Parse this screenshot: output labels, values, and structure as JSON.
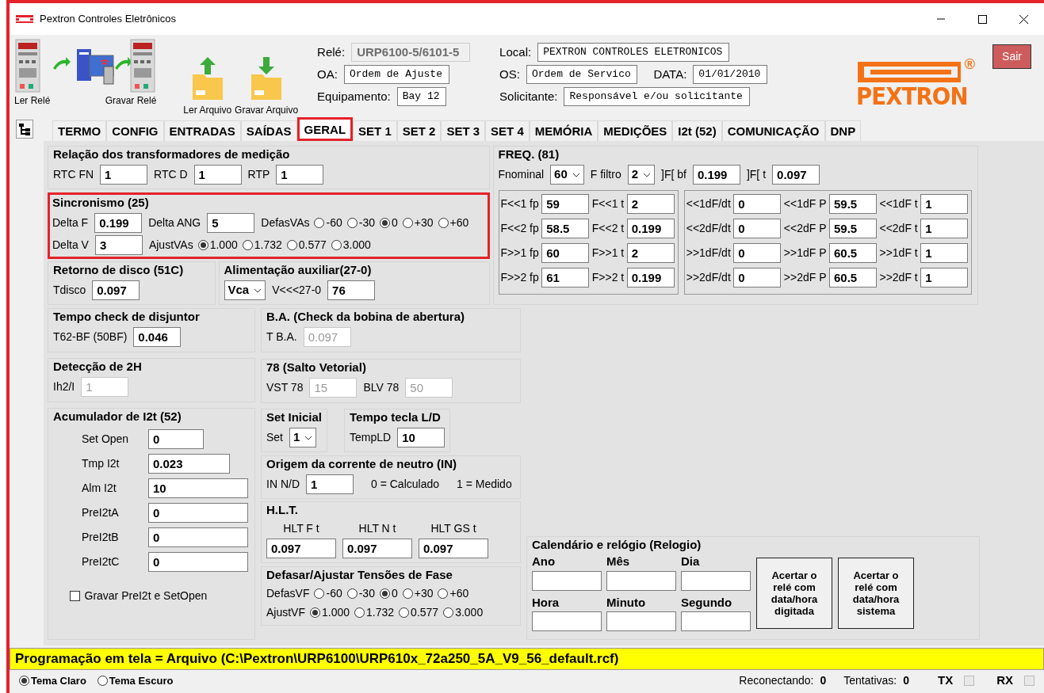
{
  "window": {
    "title": "Pextron Controles Eletrônicos"
  },
  "toolbar": {
    "buttons": [
      {
        "kind": "read_relay",
        "label": "Ler Relé"
      },
      {
        "kind": "write_relay",
        "label": "Gravar Relé"
      },
      {
        "kind": "open_file",
        "label": "Ler Arquivo"
      },
      {
        "kind": "save_file",
        "label": "Gravar Arquivo"
      }
    ]
  },
  "header": {
    "rows": [
      [
        {
          "label": "Relé:",
          "value": "URP6100-5/6101-5",
          "disabled": true
        },
        {
          "label": "Local:",
          "value": "PEXTRON CONTROLES ELETRONICOS",
          "disabled": false
        }
      ],
      [
        {
          "label": "OA:",
          "value": "Ordem de Ajuste",
          "disabled": false
        },
        {
          "label": "OS:",
          "value": "Ordem de Servico",
          "disabled": false
        },
        {
          "label": "DATA:",
          "value": "01/01/2010",
          "disabled": false
        }
      ],
      [
        {
          "label": "Equipamento:",
          "value": "Bay 12",
          "disabled": false
        },
        {
          "label": "Solicitante:",
          "value": "Responsável e/ou solicitante",
          "disabled": false
        }
      ]
    ]
  },
  "logo": {
    "text": "PEXTRON",
    "mark": "®"
  },
  "exit_button": "Sair",
  "tabs": [
    {
      "label": "TERMO",
      "selected": false
    },
    {
      "label": "CONFIG",
      "selected": false
    },
    {
      "label": "ENTRADAS",
      "selected": false
    },
    {
      "label": "SAÍDAS",
      "selected": false
    },
    {
      "label": "GERAL",
      "selected": true
    },
    {
      "label": "SET 1",
      "selected": false
    },
    {
      "label": "SET 2",
      "selected": false
    },
    {
      "label": "SET 3",
      "selected": false
    },
    {
      "label": "SET 4",
      "selected": false
    },
    {
      "label": "MEMÓRIA",
      "selected": false
    },
    {
      "label": "MEDIÇÕES",
      "selected": false
    },
    {
      "label": "I2t (52)",
      "selected": false
    },
    {
      "label": "COMUNICAÇÃO",
      "selected": false
    },
    {
      "label": "DNP",
      "selected": false
    }
  ],
  "panel": {
    "top_left": [
      {
        "kind": "form",
        "title": "Relação dos transformadores de medição",
        "highlighted": false,
        "rows": [
          [
            {
              "kind": "field",
              "label": "RTC FN",
              "value": "1",
              "disabled": false
            },
            {
              "kind": "field",
              "label": "RTC D",
              "value": "1",
              "disabled": false
            },
            {
              "kind": "field",
              "label": "RTP",
              "value": "1",
              "disabled": false
            }
          ]
        ]
      },
      {
        "kind": "form",
        "title": "Sincronismo (25)",
        "highlighted": true,
        "rows": [
          [
            {
              "kind": "field",
              "label": "Delta F",
              "value": "0.199",
              "disabled": false
            },
            {
              "kind": "field",
              "label": "Delta ANG",
              "value": "5",
              "disabled": false
            },
            {
              "kind": "radios",
              "label": "DefasVAs",
              "options": [
                {
                  "label": "-60",
                  "selected": false
                },
                {
                  "label": "-30",
                  "selected": false
                },
                {
                  "label": "0",
                  "selected": true
                },
                {
                  "label": "+30",
                  "selected": false
                },
                {
                  "label": "+60",
                  "selected": false
                }
              ]
            }
          ],
          [
            {
              "kind": "field",
              "label": "Delta V",
              "value": "3",
              "disabled": false
            },
            {
              "kind": "radios",
              "label": "AjustVAs",
              "options": [
                {
                  "label": "1.000",
                  "selected": true
                },
                {
                  "label": "1.732",
                  "selected": false
                },
                {
                  "label": "0.577",
                  "selected": false
                },
                {
                  "label": "3.000",
                  "selected": false
                }
              ]
            }
          ]
        ]
      }
    ],
    "top_left_pair": [
      {
        "kind": "form",
        "title": "Retorno de disco (51C)",
        "highlighted": false,
        "rows": [
          [
            {
              "kind": "field",
              "label": "Tdisco",
              "value": "0.097",
              "disabled": false
            }
          ]
        ]
      },
      {
        "kind": "form",
        "title": "Alimentação auxiliar(27-0)",
        "highlighted": false,
        "rows": [
          [
            {
              "kind": "select",
              "value": "Vca"
            },
            {
              "kind": "field",
              "label": "V<<<27-0",
              "value": "76",
              "disabled": false
            }
          ]
        ]
      }
    ],
    "freq": {
      "kind": "freq",
      "title": "FREQ. (81)",
      "highlighted": false,
      "rows": [
        [
          {
            "kind": "select",
            "label": "Fnominal",
            "value": "60"
          },
          {
            "kind": "select",
            "label": "F filtro",
            "value": "2"
          },
          {
            "kind": "field",
            "label": "]F[  bf",
            "value": "0.199",
            "disabled": false
          },
          {
            "kind": "field",
            "label": "]F[  t",
            "value": "0.097",
            "disabled": false
          }
        ]
      ],
      "grids": [
        {
          "rows": [
            [
              {
                "kind": "field",
                "label": "F<<1 fp",
                "value": "59",
                "disabled": false
              },
              {
                "kind": "field",
                "label": "F<<1 t",
                "value": "2",
                "disabled": false
              }
            ],
            [
              {
                "kind": "field",
                "label": "F<<2 fp",
                "value": "58.5",
                "disabled": false
              },
              {
                "kind": "field",
                "label": "F<<2 t",
                "value": "0.199",
                "disabled": false
              }
            ],
            [
              {
                "kind": "field",
                "label": "F>>1 fp",
                "value": "60",
                "disabled": false
              },
              {
                "kind": "field",
                "label": "F>>1 t",
                "value": "2",
                "disabled": false
              }
            ],
            [
              {
                "kind": "field",
                "label": "F>>2 fp",
                "value": "61",
                "disabled": false
              },
              {
                "kind": "field",
                "label": "F>>2 t",
                "value": "0.199",
                "disabled": false
              }
            ]
          ]
        },
        {
          "rows": [
            [
              {
                "kind": "field",
                "label": "<<1dF/dt",
                "value": "0",
                "disabled": false
              },
              {
                "kind": "field",
                "label": "<<1dF P",
                "value": "59.5",
                "disabled": false
              },
              {
                "kind": "field",
                "label": "<<1dF t",
                "value": "1",
                "disabled": false
              }
            ],
            [
              {
                "kind": "field",
                "label": "<<2dF/dt",
                "value": "0",
                "disabled": false
              },
              {
                "kind": "field",
                "label": "<<2dF P",
                "value": "59.5",
                "disabled": false
              },
              {
                "kind": "field",
                "label": "<<2dF t",
                "value": "1",
                "disabled": false
              }
            ],
            [
              {
                "kind": "field",
                "label": ">>1dF/dt",
                "value": "0",
                "disabled": false
              },
              {
                "kind": "field",
                "label": ">>1dF P",
                "value": "60.5",
                "disabled": false
              },
              {
                "kind": "field",
                "label": ">>1dF t",
                "value": "1",
                "disabled": false
              }
            ],
            [
              {
                "kind": "field",
                "label": ">>2dF/dt",
                "value": "0",
                "disabled": false
              },
              {
                "kind": "field",
                "label": ">>2dF P",
                "value": "60.5",
                "disabled": false
              },
              {
                "kind": "field",
                "label": ">>2dF t",
                "value": "1",
                "disabled": false
              }
            ]
          ]
        }
      ]
    },
    "left": [
      {
        "kind": "form",
        "title": "Tempo check de disjuntor",
        "highlighted": false,
        "rows": [
          [
            {
              "kind": "field",
              "label": "T62-BF (50BF)",
              "value": "0.046",
              "disabled": false
            }
          ]
        ]
      },
      {
        "kind": "form",
        "title": "Detecção de 2H",
        "highlighted": false,
        "rows": [
          [
            {
              "kind": "field",
              "label": "Ih2/I",
              "value": "1",
              "disabled": true
            }
          ]
        ]
      },
      {
        "kind": "table_form",
        "title": "Acumulador de I2t (52)",
        "highlighted": false,
        "rows": [
          [
            {
              "kind": "field",
              "label": "Set Open",
              "value": "0",
              "disabled": false
            }
          ],
          [
            {
              "kind": "field",
              "label": "Tmp I2t",
              "value": "0.023",
              "disabled": false
            }
          ],
          [
            {
              "kind": "field",
              "label": "Alm I2t",
              "value": "10",
              "disabled": false
            }
          ],
          [
            {
              "kind": "field",
              "label": "PreI2tA",
              "value": "0",
              "disabled": false
            }
          ],
          [
            {
              "kind": "field",
              "label": "PreI2tB",
              "value": "0",
              "disabled": false
            }
          ],
          [
            {
              "kind": "field",
              "label": "PreI2tC",
              "value": "0",
              "disabled": false
            }
          ],
          [
            {
              "kind": "checkbox",
              "label": "Gravar PreI2t e SetOpen",
              "checked": false
            }
          ]
        ]
      }
    ],
    "middle": [
      {
        "kind": "form",
        "title": "B.A. (Check da bobina de abertura)",
        "highlighted": false,
        "rows": [
          [
            {
              "kind": "field",
              "label": "T B.A.",
              "value": "0.097",
              "disabled": true
            }
          ]
        ]
      },
      {
        "kind": "form",
        "title": "78 (Salto Vetorial)",
        "highlighted": false,
        "rows": [
          [
            {
              "kind": "field",
              "label": "VST 78",
              "value": "15",
              "disabled": true
            },
            {
              "kind": "field",
              "label": "BLV 78",
              "value": "50",
              "disabled": true
            }
          ]
        ]
      }
    ],
    "middle_pair": [
      {
        "kind": "form",
        "title": "Set Inicial",
        "highlighted": false,
        "rows": [
          [
            {
              "kind": "select",
              "label": "Set",
              "value": "1"
            }
          ]
        ]
      },
      {
        "kind": "form",
        "title": "Tempo tecla L/D",
        "highlighted": false,
        "rows": [
          [
            {
              "kind": "field",
              "label": "TempLD",
              "value": "10",
              "disabled": false
            }
          ]
        ]
      }
    ],
    "middle_rest": [
      {
        "kind": "form",
        "title": "Origem da corrente de neutro (IN)",
        "highlighted": false,
        "rows": [
          [
            {
              "kind": "field",
              "label": "IN N/D",
              "value": "1",
              "disabled": false
            },
            {
              "kind": "text",
              "label": "0 = Calculado"
            },
            {
              "kind": "text",
              "label": "1 = Medido"
            }
          ]
        ]
      },
      {
        "kind": "form",
        "title": "H.L.T.",
        "highlighted": false,
        "rows": [
          [
            {
              "kind": "stacked_field",
              "label": "HLT F t",
              "value": "0.097"
            },
            {
              "kind": "stacked_field",
              "label": "HLT N t",
              "value": "0.097"
            },
            {
              "kind": "stacked_field",
              "label": "HLT GS t",
              "value": "0.097"
            }
          ]
        ]
      },
      {
        "kind": "form",
        "title": "Defasar/Ajustar Tensões de Fase",
        "highlighted": false,
        "rows": [
          [
            {
              "kind": "radios",
              "label": "DefasVF",
              "options": [
                {
                  "label": "-60",
                  "selected": false
                },
                {
                  "label": "-30",
                  "selected": false
                },
                {
                  "label": "0",
                  "selected": true
                },
                {
                  "label": "+30",
                  "selected": false
                },
                {
                  "label": "+60",
                  "selected": false
                }
              ]
            }
          ],
          [
            {
              "kind": "radios",
              "label": "AjustVF",
              "options": [
                {
                  "label": "1.000",
                  "selected": true
                },
                {
                  "label": "1.732",
                  "selected": false
                },
                {
                  "label": "0.577",
                  "selected": false
                },
                {
                  "label": "3.000",
                  "selected": false
                }
              ]
            }
          ]
        ]
      }
    ],
    "right": [
      {
        "kind": "calendar",
        "title": "Calendário e relógio (Relogio)",
        "highlighted": false,
        "fields": [
          {
            "label": "Ano"
          },
          {
            "label": "Mês"
          },
          {
            "label": "Dia"
          },
          {
            "label": "Hora"
          },
          {
            "label": "Minuto"
          },
          {
            "label": "Segundo"
          }
        ],
        "buttons": [
          "Acertar o relé com data/hora digitada",
          "Acertar o relé com data/hora sistema"
        ]
      }
    ]
  },
  "status_message": "Programação em tela = Arquivo (C:\\Pextron\\URP6100\\URP610x_72a250_5A_V9_56_default.rcf)",
  "footer": {
    "themes": [
      {
        "label": "Tema Claro",
        "selected": true
      },
      {
        "label": "Tema Escuro",
        "selected": false
      }
    ],
    "counters": [
      {
        "label": "Reconectando:",
        "value": "0"
      },
      {
        "label": "Tentativas:",
        "value": "0"
      }
    ],
    "indicators": [
      {
        "label": "TX",
        "on": false
      },
      {
        "label": "RX",
        "on": false
      }
    ]
  }
}
